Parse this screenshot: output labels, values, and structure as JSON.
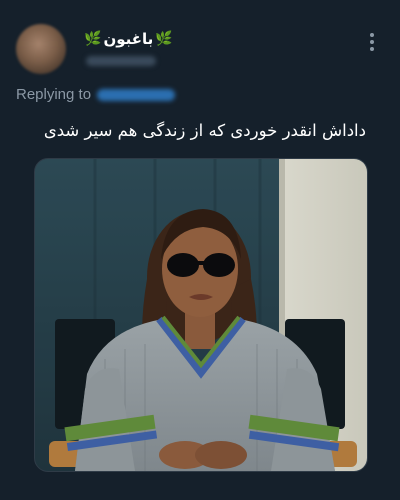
{
  "author": {
    "display_name": "باغبون",
    "leaf_left": "🌿",
    "leaf_right": "🌿"
  },
  "reply": {
    "label": "Replying to"
  },
  "tweet": {
    "text": "داداش انقدر خوردی که از زندگی هم سیر شدی"
  },
  "colors": {
    "background": "#15202b",
    "muted": "#8b98a5",
    "link": "#1d9bf0"
  },
  "icons": {
    "more": "more-vertical-icon"
  }
}
